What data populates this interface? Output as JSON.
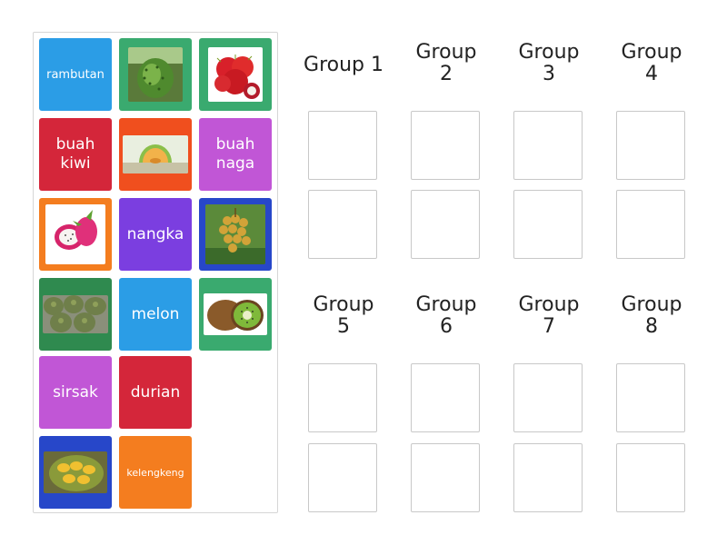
{
  "tiles": {
    "rambutan": "rambutan",
    "buah_kiwi": "buah kiwi",
    "buah_naga": "buah naga",
    "nangka": "nangka",
    "melon": "melon",
    "sirsak": "sirsak",
    "durian": "durian",
    "kelengkeng": "kelengkeng"
  },
  "image_tiles": [
    "soursop-image",
    "rambutan-image",
    "melon-image",
    "dragon-fruit-image",
    "longan-image",
    "durian-image",
    "kiwi-image",
    "jackfruit-image"
  ],
  "groups": [
    "Group 1",
    "Group 2",
    "Group 3",
    "Group 4",
    "Group 5",
    "Group 6",
    "Group 7",
    "Group 8"
  ],
  "colors": {
    "blue": "#2b9de6",
    "green": "#3aaa6f",
    "red": "#d4263a",
    "orange": "#f47d1f",
    "magenta": "#c156d6",
    "purple": "#7b3ee0",
    "darkblue": "#2747c9",
    "darkgreen": "#2f8a4f"
  }
}
